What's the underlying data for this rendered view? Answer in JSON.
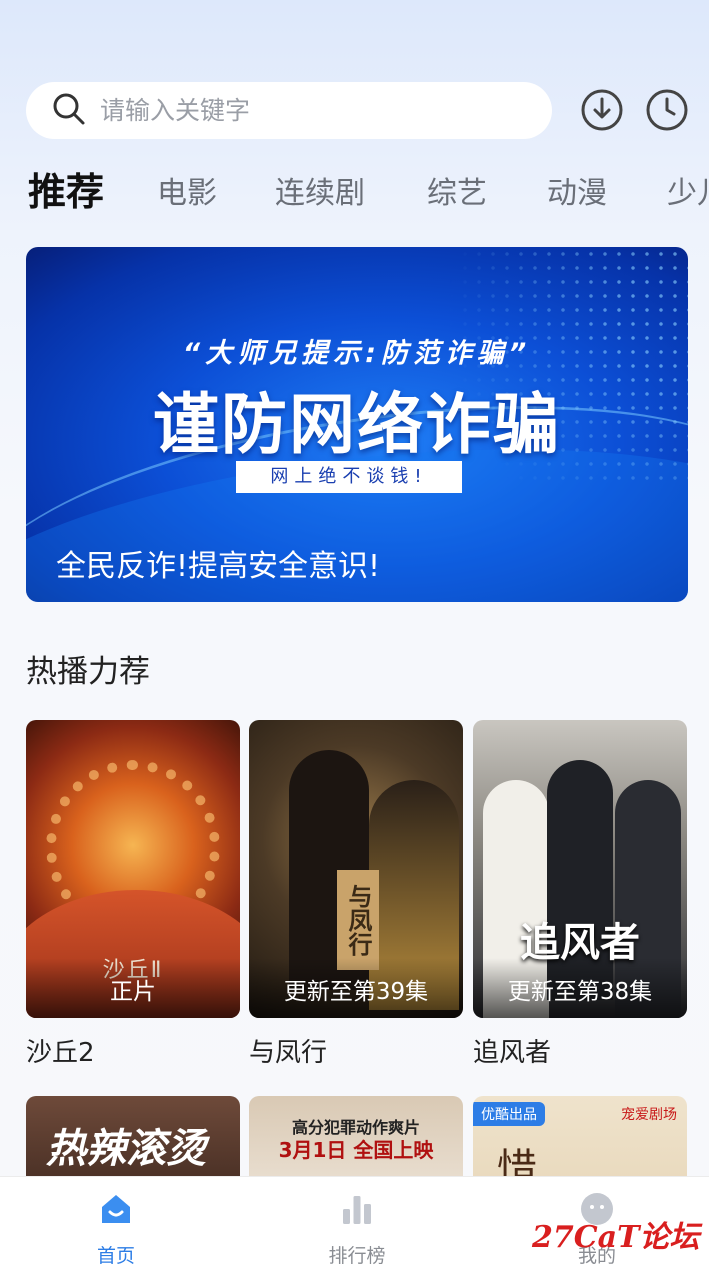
{
  "search": {
    "placeholder": "请输入关键字"
  },
  "header_icons": [
    "download-icon",
    "history-icon"
  ],
  "tabs": [
    {
      "label": "推荐",
      "active": true
    },
    {
      "label": "电影"
    },
    {
      "label": "连续剧"
    },
    {
      "label": "综艺"
    },
    {
      "label": "动漫"
    },
    {
      "label": "少儿"
    }
  ],
  "banner": {
    "subtitle": "“大师兄提示:防范诈骗”",
    "title": "谨防网络诈骗",
    "tag": "网上绝不谈钱!",
    "caption": "全民反诈!提高安全意识!"
  },
  "section": {
    "title": "热播力荐"
  },
  "posters": [
    {
      "title": "沙丘2",
      "badge": "正片",
      "poster_text": "沙丘Ⅱ"
    },
    {
      "title": "与凤行",
      "badge": "更新至第39集",
      "poster_text": "与凤行"
    },
    {
      "title": "追风者",
      "badge": "更新至第38集",
      "poster_text": "追风者"
    }
  ],
  "posters_row2": [
    {
      "text": "热辣滚烫"
    },
    {
      "line1": "高分犯罪动作爽片",
      "line2": "3月1日 全国上映"
    },
    {
      "tag": "优酷出品",
      "text": "惜",
      "corner": "宠爱剧场"
    }
  ],
  "bottom_nav": [
    {
      "label": "首页",
      "icon": "home-icon",
      "active": true
    },
    {
      "label": "排行榜",
      "icon": "ranking-icon"
    },
    {
      "label": "我的",
      "icon": "profile-icon"
    }
  ],
  "watermark": "27CaT论坛",
  "colors": {
    "accent": "#2d7de6",
    "banner_blue": "#0c4fd6"
  }
}
